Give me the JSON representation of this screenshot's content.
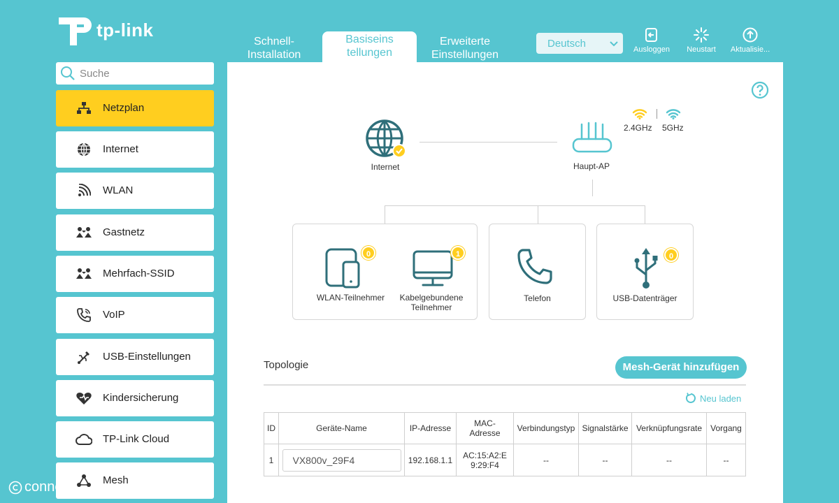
{
  "brand": {
    "logo_text": "tp-link"
  },
  "tabs": [
    {
      "label": "Schnell-\nInstallation"
    },
    {
      "label": "Basiseins\ntellungen"
    },
    {
      "label": "Erweiterte\nEinstellungen"
    }
  ],
  "language": {
    "selected": "Deutsch"
  },
  "actions": {
    "logout": "Ausloggen",
    "restart": "Neustart",
    "update": "Aktualisie..."
  },
  "sidebar": {
    "search_placeholder": "Suche",
    "items": [
      {
        "label": "Netzplan",
        "icon": "network-map-icon",
        "active": true
      },
      {
        "label": "Internet",
        "icon": "globe-icon"
      },
      {
        "label": "WLAN",
        "icon": "wifi-icon"
      },
      {
        "label": "Gastnetz",
        "icon": "guest-network-icon"
      },
      {
        "label": "Mehrfach-SSID",
        "icon": "multi-ssid-icon"
      },
      {
        "label": "VoIP",
        "icon": "phone-icon"
      },
      {
        "label": "USB-Einstellungen",
        "icon": "usb-icon"
      },
      {
        "label": "Kindersicherung",
        "icon": "heart-icon"
      },
      {
        "label": "TP-Link Cloud",
        "icon": "cloud-icon"
      },
      {
        "label": "Mesh",
        "icon": "mesh-icon"
      }
    ]
  },
  "network_map": {
    "internet_label": "Internet",
    "router_label": "Haupt-AP",
    "band_24": "2.4GHz",
    "band_5": "5GHz",
    "wlan_clients": {
      "label": "WLAN-Teilnehmer",
      "count": "0"
    },
    "wired_clients": {
      "label": "Kabelgebundene\nTeilnehmer",
      "count": "1"
    },
    "phone": {
      "label": "Telefon"
    },
    "usb": {
      "label": "USB-Datenträger",
      "count": "0"
    }
  },
  "topology": {
    "title": "Topologie",
    "add_mesh_button": "Mesh-Gerät hinzufügen",
    "reload_label": "Neu laden",
    "columns": [
      "ID",
      "Geräte-Name",
      "IP-Adresse",
      "MAC-\nAdresse",
      "Verbindungstyp",
      "Signalstärke",
      "Verknüpfungsrate",
      "Vorgang"
    ],
    "rows": [
      {
        "id": "1",
        "name": "VX800v_29F4",
        "ip": "192.168.1.1",
        "mac": "AC:15:A2:E\n9:29:F4",
        "type": "--",
        "signal": "--",
        "rate": "--",
        "action": "--"
      }
    ]
  },
  "watermark": "connect",
  "colors": {
    "accent": "#56c5d0",
    "highlight": "#ffce1f",
    "dark_icon": "#2f6f7a"
  }
}
